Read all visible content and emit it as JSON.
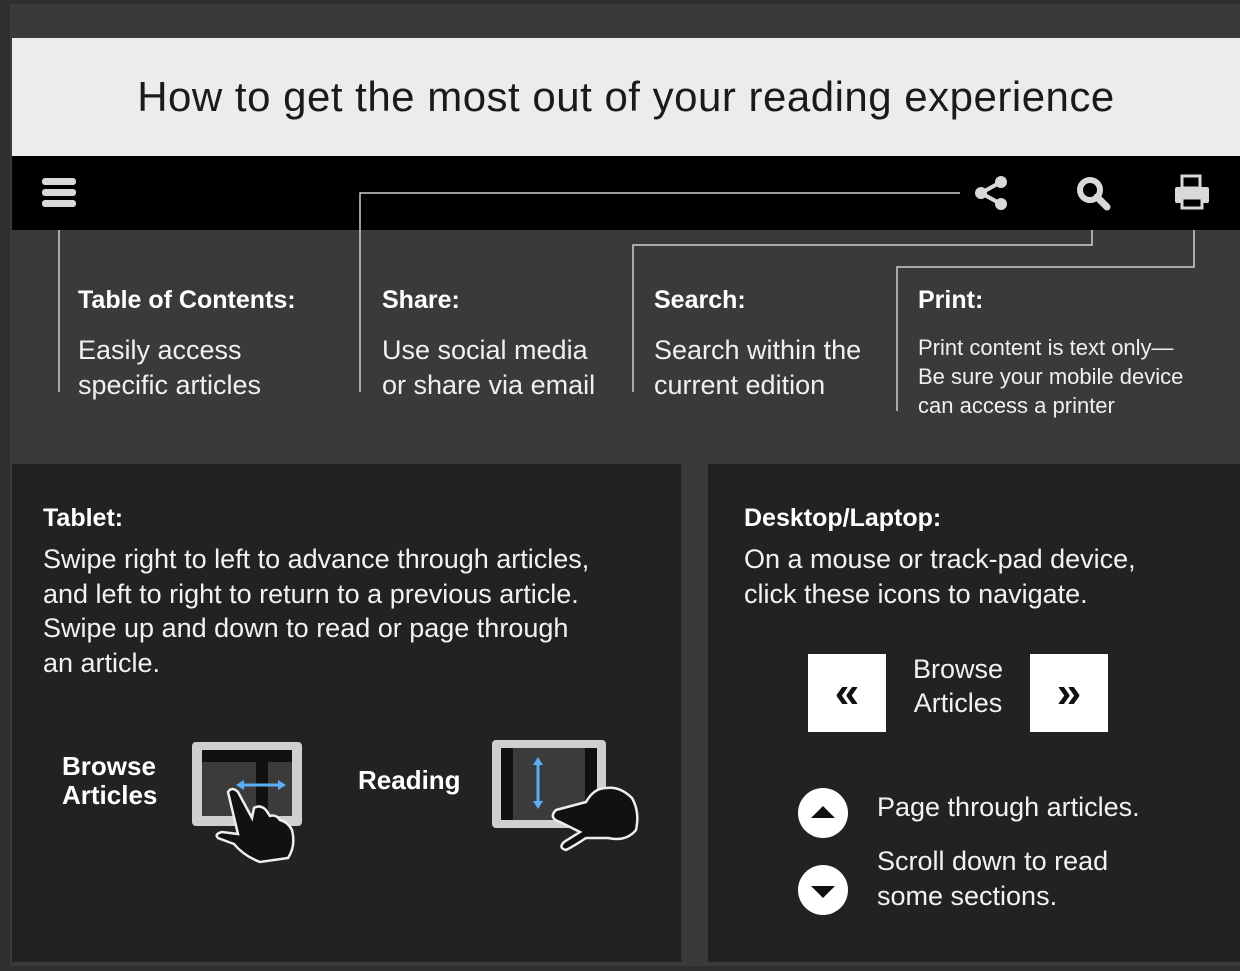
{
  "title": "How to get the most out of your reading experience",
  "toolbar": {
    "menu_icon": "hamburger-menu-icon",
    "share_icon": "share-icon",
    "search_icon": "search-icon",
    "print_icon": "print-icon"
  },
  "features": [
    {
      "heading": "Table of Contents:",
      "lines": [
        "Easily access",
        "specific articles"
      ]
    },
    {
      "heading": "Share:",
      "lines": [
        "Use social media",
        "or share via email"
      ]
    },
    {
      "heading": "Search:",
      "lines": [
        "Search within the",
        "current edition"
      ]
    },
    {
      "heading": "Print:",
      "lines": [
        "Print content is text only—",
        "Be sure your mobile device",
        "can access a printer"
      ]
    }
  ],
  "tablet": {
    "heading": "Tablet:",
    "lines": [
      "Swipe right to left to advance through articles,",
      "and left to right to return to a previous article.",
      "Swipe up and down to read or page through",
      "an article."
    ],
    "browse_label": [
      "Browse",
      "Articles"
    ],
    "reading_label": "Reading"
  },
  "desktop": {
    "heading": "Desktop/Laptop:",
    "lines": [
      "On a mouse or track-pad device,",
      "click these icons to navigate."
    ],
    "prev_glyph": "«",
    "next_glyph": "»",
    "browse_label": [
      "Browse",
      "Articles"
    ],
    "page_text": "Page through articles.",
    "scroll_text": [
      "Scroll down to read",
      "some sections."
    ]
  },
  "colors": {
    "background": "#3a3a3a",
    "banner": "#ececec",
    "toolbar": "#000000",
    "panel": "#222222",
    "accent_arrow": "#5aaef5"
  }
}
